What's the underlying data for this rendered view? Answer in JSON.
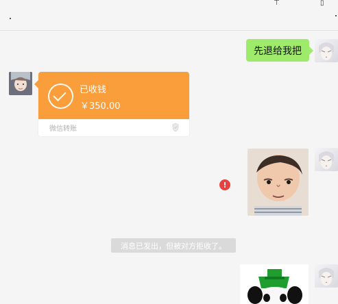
{
  "window": {
    "top_left_dot": "·",
    "top_right_dot": "·",
    "top_icon_left": "⊤",
    "top_icon_right": "▯"
  },
  "messages": {
    "text_message": "先退给我把",
    "transfer": {
      "status": "已收钱",
      "amount": "￥350.00",
      "source": "微信转账"
    },
    "error_badge": "!",
    "system_note": "消息已发出，但被对方拒收了。"
  },
  "colors": {
    "green_bubble": "#9eea6a",
    "transfer_orange": "#fa9d3b",
    "error_red": "#e64340"
  }
}
